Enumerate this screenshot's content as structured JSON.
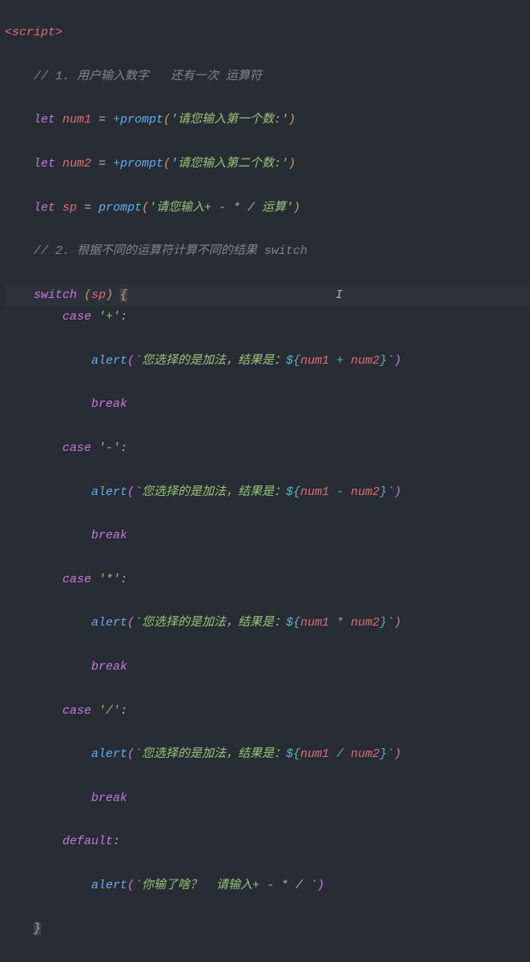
{
  "code": {
    "line1": {
      "tag_open": "<",
      "tag_name": "script",
      "tag_close": ">"
    },
    "line2": {
      "indent": "    ",
      "comment": "// 1. 用户输入数字   还有一次 运算符"
    },
    "line3": {
      "indent": "    ",
      "kw": "let",
      "var": "num1",
      "eq": " = ",
      "op": "+",
      "fn": "prompt",
      "p1": "(",
      "str": "'请您输入第一个数:'",
      "p2": ")"
    },
    "line4": {
      "indent": "    ",
      "kw": "let",
      "var": "num2",
      "eq": " = ",
      "op": "+",
      "fn": "prompt",
      "p1": "(",
      "str": "'请您输入第二个数:'",
      "p2": ")"
    },
    "line5": {
      "indent": "    ",
      "kw": "let",
      "var": "sp",
      "eq": " = ",
      "fn": "prompt",
      "p1": "(",
      "str": "'请您输入+ - * / 运算'",
      "p2": ")"
    },
    "line6": {
      "indent": "    ",
      "comment": "// 2. 根据不同的运算符计算不同的结果 switch"
    },
    "line7": {
      "indent": "    ",
      "kw": "switch",
      "sp": " ",
      "p1": "(",
      "var": "sp",
      "p2": ")",
      "sp2": " ",
      "brace": "{"
    },
    "line8": {
      "indent": "        ",
      "kw": "case",
      "sp": " ",
      "str": "'+'",
      "colon": ":"
    },
    "line9": {
      "indent": "            ",
      "fn": "alert",
      "p1": "(",
      "tick1": "`",
      "txt": "您选择的是加法，结果是：",
      "dollar": "${",
      "v1": "num1",
      "op": " + ",
      "v2": "num2",
      "close": "}",
      "tick2": "`",
      "p2": ")"
    },
    "line10": {
      "indent": "            ",
      "kw": "break"
    },
    "line11": {
      "indent": "        ",
      "kw": "case",
      "sp": " ",
      "str": "'-'",
      "colon": ":"
    },
    "line12": {
      "indent": "            ",
      "fn": "alert",
      "p1": "(",
      "tick1": "`",
      "txt": "您选择的是加法，结果是：",
      "dollar": "${",
      "v1": "num1",
      "op": " - ",
      "v2": "num2",
      "close": "}",
      "tick2": "`",
      "p2": ")"
    },
    "line13": {
      "indent": "            ",
      "kw": "break"
    },
    "line14": {
      "indent": "        ",
      "kw": "case",
      "sp": " ",
      "str": "'*'",
      "colon": ":"
    },
    "line15": {
      "indent": "            ",
      "fn": "alert",
      "p1": "(",
      "tick1": "`",
      "txt": "您选择的是加法，结果是：",
      "dollar": "${",
      "v1": "num1",
      "op": " * ",
      "v2": "num2",
      "close": "}",
      "tick2": "`",
      "p2": ")"
    },
    "line16": {
      "indent": "            ",
      "kw": "break"
    },
    "line17": {
      "indent": "        ",
      "kw": "case",
      "sp": " ",
      "str": "'/'",
      "colon": ":"
    },
    "line18": {
      "indent": "            ",
      "fn": "alert",
      "p1": "(",
      "tick1": "`",
      "txt": "您选择的是加法，结果是：",
      "dollar": "${",
      "v1": "num1",
      "op": " / ",
      "v2": "num2",
      "close": "}",
      "tick2": "`",
      "p2": ")"
    },
    "line19": {
      "indent": "            ",
      "kw": "break"
    },
    "line20": {
      "indent": "        ",
      "kw": "default",
      "colon": ":"
    },
    "line21": {
      "indent": "            ",
      "fn": "alert",
      "p1": "(",
      "tick1": "`",
      "txt": "你输了啥？  请输入+ - * / ",
      "tick2": "`",
      "p2": ")"
    },
    "line22": {
      "indent": "    ",
      "brace": "}"
    }
  }
}
